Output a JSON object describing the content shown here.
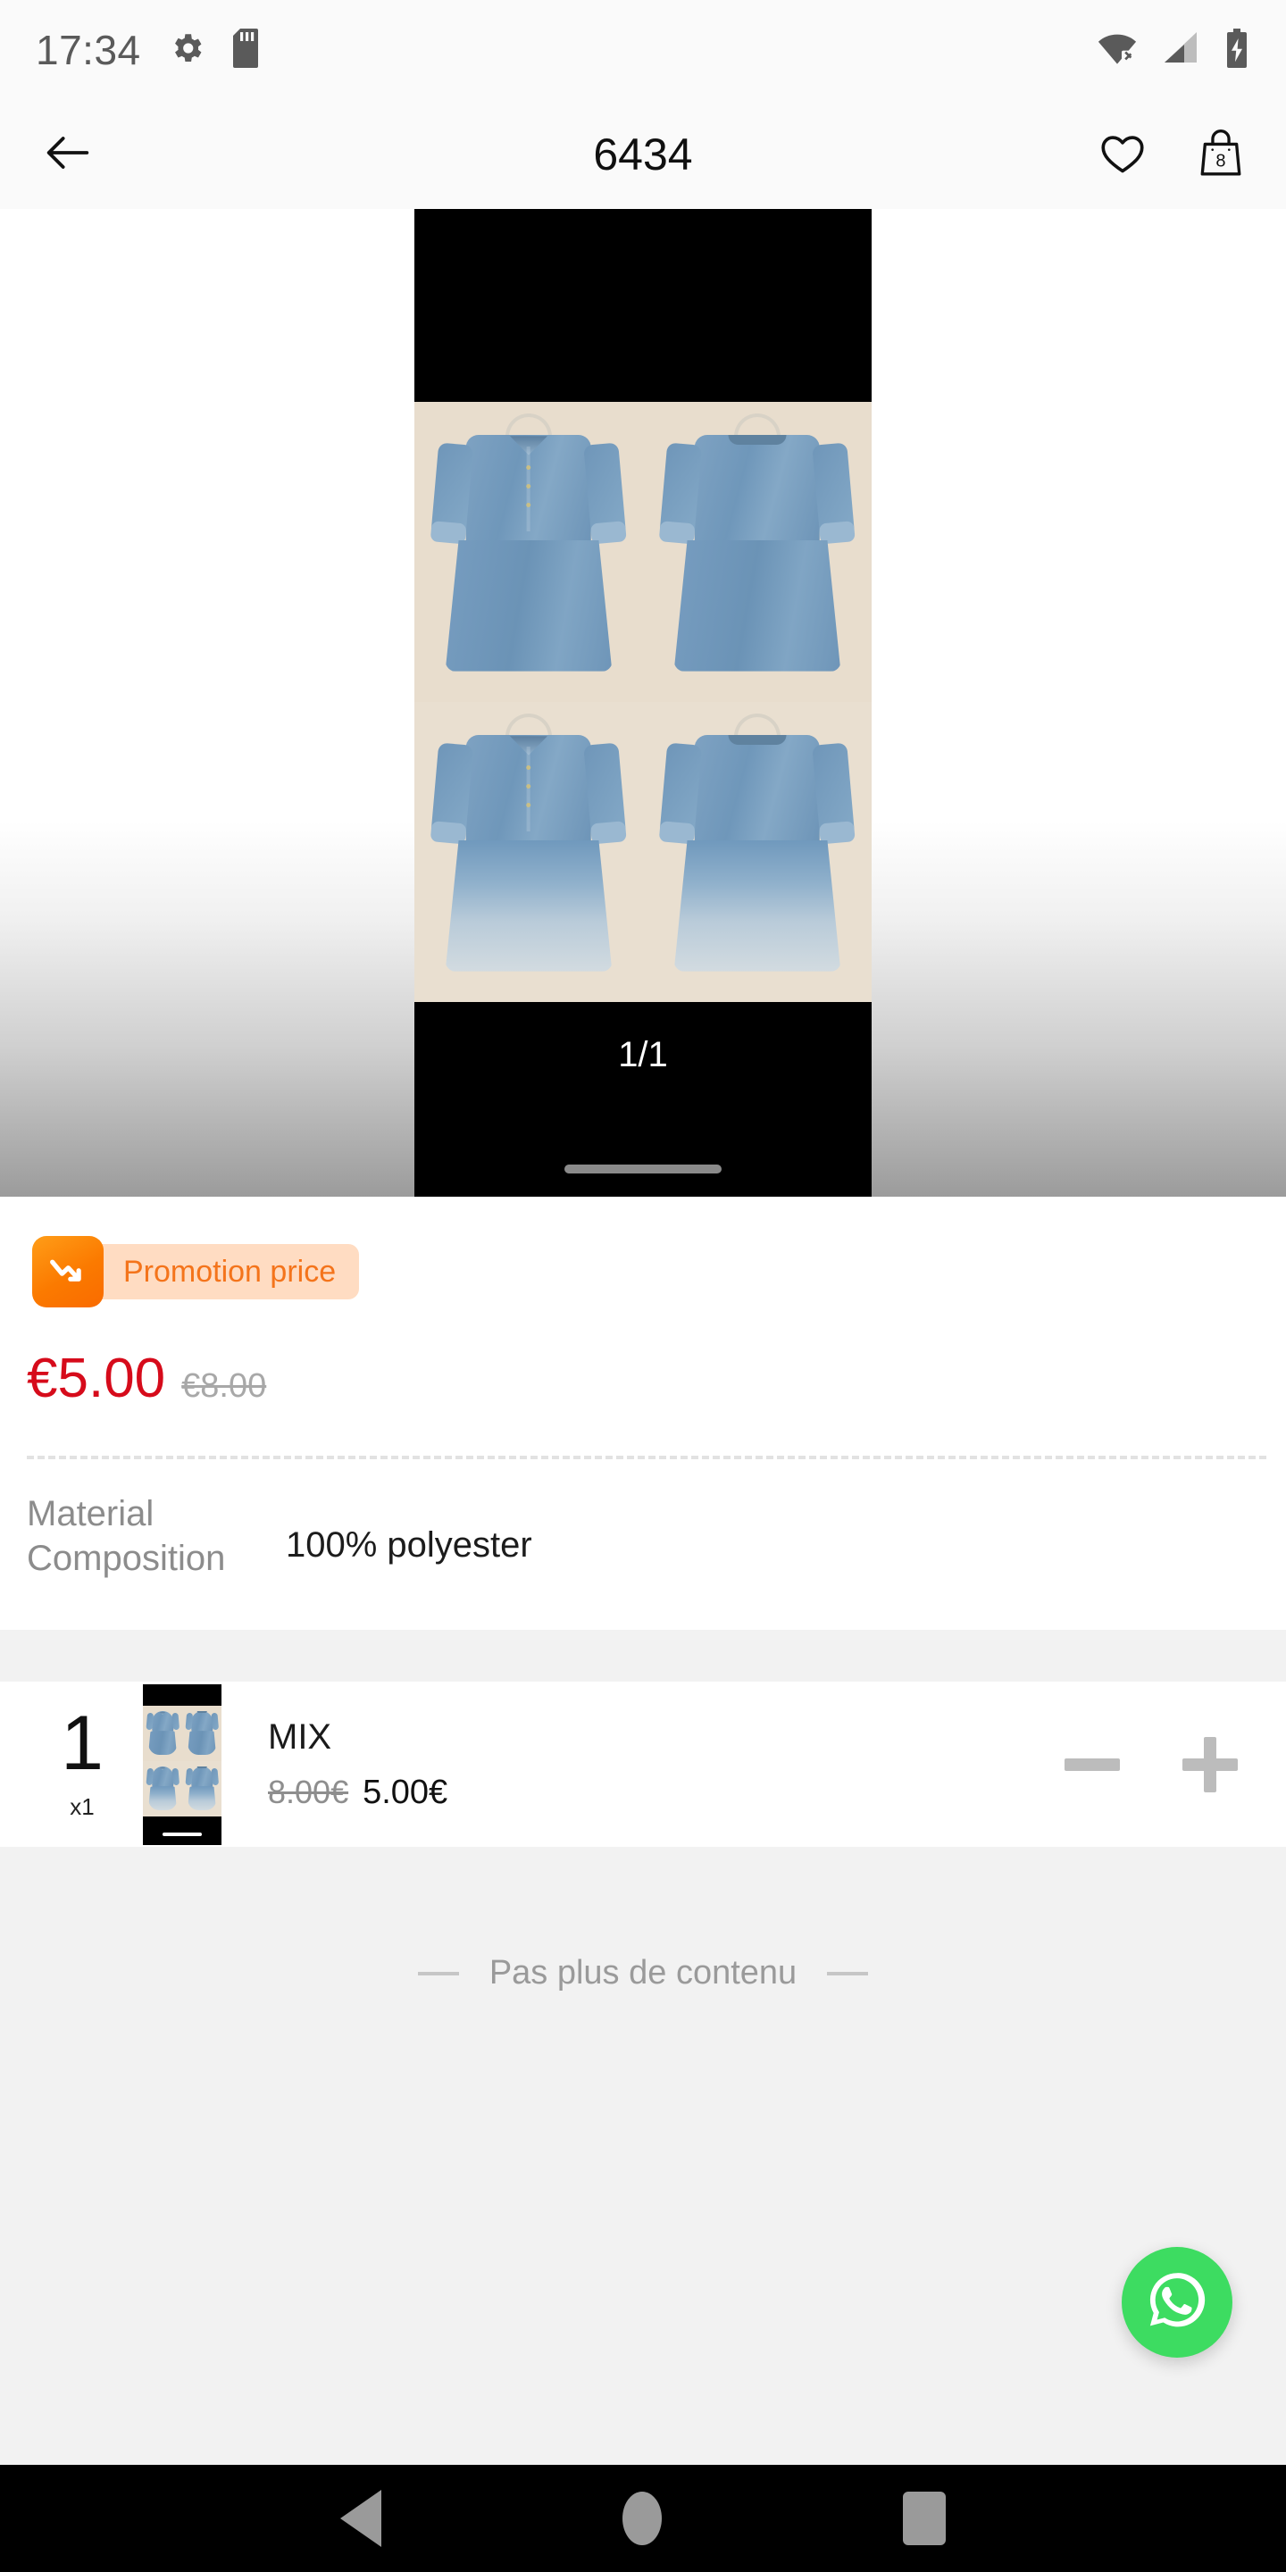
{
  "status_bar": {
    "time": "17:34",
    "icons_left": [
      "gear-icon",
      "sd-card-icon"
    ],
    "icons_right": [
      "wifi-off-icon",
      "cell-signal-icon",
      "battery-charging-icon"
    ]
  },
  "app_bar": {
    "back_icon": "back-arrow-icon",
    "title": "6434",
    "wishlist_icon": "heart-icon",
    "cart_icon": "shopping-bag-icon",
    "cart_count": "8"
  },
  "gallery": {
    "page_indicator": "1/1",
    "photo_alt": "denim shirt dress 2x2 grid"
  },
  "detail": {
    "promotion_label": "Promotion price",
    "promotion_icon": "trending-down-icon",
    "price_current": "€5.00",
    "price_original": "€8.00",
    "spec_label": "Material Composition",
    "spec_value": "100% polyester"
  },
  "cart_item": {
    "index": "1",
    "quantity_label": "x1",
    "title": "MIX",
    "price_original": "8.00€",
    "price_current": "5.00€",
    "decrement_icon": "minus-icon",
    "increment_icon": "plus-icon"
  },
  "footer": {
    "no_more_text": "Pas plus de contenu"
  },
  "fab": {
    "icon": "whatsapp-icon"
  },
  "nav_bar": {
    "back": "nav-back-icon",
    "home": "nav-home-icon",
    "recents": "nav-recents-icon"
  },
  "colors": {
    "promo_orange": "#f4741b",
    "promo_pill_bg": "#ffdcc2",
    "price_red": "#d60b1b",
    "whatsapp_green": "#3ddc61",
    "page_bg": "#f2f2f2"
  }
}
